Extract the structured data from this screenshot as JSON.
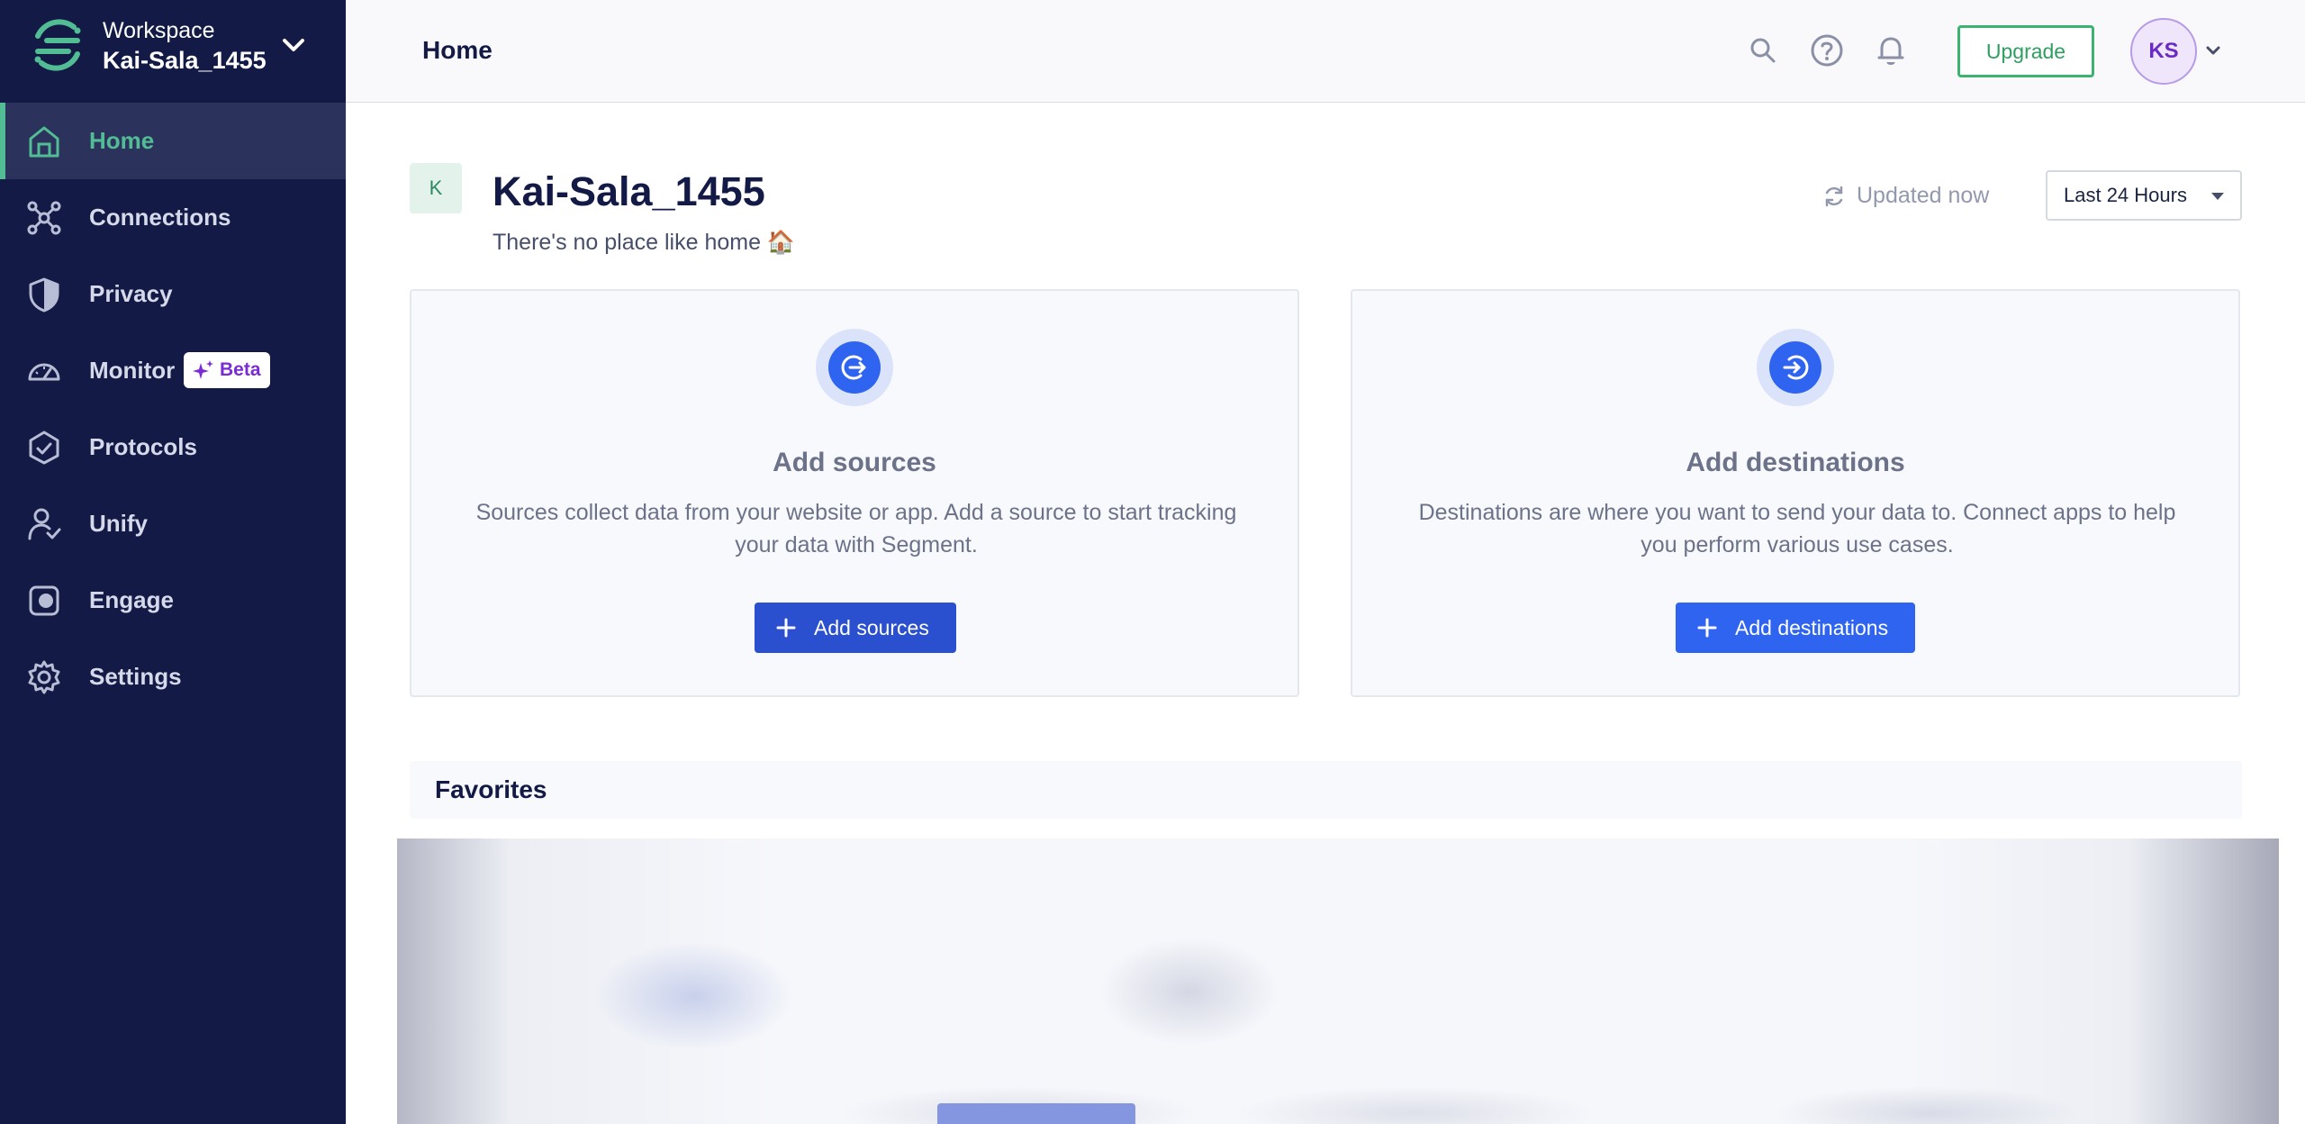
{
  "workspace": {
    "label": "Workspace",
    "name": "Kai-Sala_1455"
  },
  "nav": {
    "home": "Home",
    "connections": "Connections",
    "privacy": "Privacy",
    "monitor": "Monitor",
    "monitor_badge": "Beta",
    "protocols": "Protocols",
    "unify": "Unify",
    "engage": "Engage",
    "settings": "Settings"
  },
  "topbar": {
    "title": "Home",
    "upgrade_label": "Upgrade",
    "avatar_initials": "KS"
  },
  "header": {
    "initial": "K",
    "title": "Kai-Sala_1455",
    "tagline": "There's no place like home 🏠",
    "updated": "Updated now",
    "range": "Last 24 Hours"
  },
  "cards": {
    "sources": {
      "title": "Add sources",
      "description": "Sources collect data from your website or app. Add a source to start tracking your data with Segment.",
      "button": "Add sources"
    },
    "destinations": {
      "title": "Add destinations",
      "description": "Destinations are where you want to send your data to. Connect apps to help you perform various use cases.",
      "button": "Add destinations"
    }
  },
  "favorites": {
    "title": "Favorites"
  },
  "colors": {
    "sidebar": "#121a45",
    "accent_green": "#52bd94",
    "primary_blue": "#2f64f0",
    "beta_purple": "#7a2bd6"
  }
}
